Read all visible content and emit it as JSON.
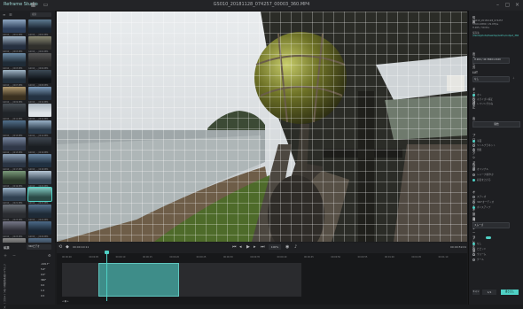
{
  "app": {
    "logo": "Reframe Studio",
    "window_title": "GS010_20181128_074257_00003_360.MP4"
  },
  "left_panel": {
    "search_placeholder": "検索",
    "thumbs": [
      {
        "label": "GS010_..._0001.MP4"
      },
      {
        "label": "GS010_..._0002.MP4"
      },
      {
        "label": "GS010_..._0003.MP4"
      },
      {
        "label": "GS010_..._0004.MP4"
      },
      {
        "label": "GS010_..._0005.MP4"
      },
      {
        "label": "GS010_..._0006.MP4"
      },
      {
        "label": "GS010_..._0007.MP4"
      },
      {
        "label": "GS010_..._0008.MP4"
      },
      {
        "label": "GS010_..._0009.MP4"
      },
      {
        "label": "GS010_..._0010.MP4"
      },
      {
        "label": "GS010_..._0011.MP4"
      },
      {
        "label": "GS010_..._0012.MP4"
      },
      {
        "label": "GS010_..._0013.MP4"
      },
      {
        "label": "GS010_..._0014.MP4"
      },
      {
        "label": "GS010_..._0015.MP4"
      },
      {
        "label": "GS010_..._0016.MP4"
      },
      {
        "label": "GS010_..._0017.MP4"
      },
      {
        "label": "GS010_..._0018.MP4"
      },
      {
        "label": "GS010_..._0019.MP4"
      },
      {
        "label": "GS010_..._0020.MP4"
      },
      {
        "label": "GS010_..._0021.MP4"
      },
      {
        "label": "GS010_..._0022.MP4"
      },
      {
        "label": "GS010_..._0023.MP4"
      },
      {
        "label": "GS010_..._0024.MP4"
      },
      {
        "label": "GS010_..._0025.MP4"
      },
      {
        "label": "GS010_..._0026.MP4"
      },
      {
        "label": "GS010_..._0027.MP4"
      },
      {
        "label": "GS010_..._0028.MP4"
      },
      {
        "label": "GS010_..._0029.MP4"
      },
      {
        "label": "GS010_..._0030.MP4"
      },
      {
        "label": "GS010_..._0031.MP4"
      },
      {
        "label": "GS010_..._0032.MP4"
      }
    ]
  },
  "transport": {
    "timecode_left": "00:00:10:11",
    "zoom": "100%",
    "timecode_right": "00:00:59:01"
  },
  "bottom_left": {
    "section": "編集",
    "dropdown": "360ビデオ",
    "properties": [
      {
        "label": "ヘディング",
        "value": "-109.7°"
      },
      {
        "label": "ピッチ",
        "value": "5.6°"
      },
      {
        "label": "ロール",
        "value": "0.0°"
      },
      {
        "label": "視野",
        "value": "360°"
      },
      {
        "label": "歪み",
        "value": "0.0"
      },
      {
        "label": "ズーム",
        "value": "1.0"
      },
      {
        "label": "スムーズ",
        "value": "0.5"
      }
    ]
  },
  "timeline": {
    "ruler": [
      "00:00:00",
      "00:00:05",
      "00:00:10",
      "00:00:15",
      "00:00:20",
      "00:00:25",
      "00:00:30",
      "00:00:35",
      "00:00:40",
      "00:00:45",
      "00:00:50",
      "00:00:55",
      "00:01:00",
      "00:01:05",
      "00:01:10"
    ],
    "playhead_fraction": 0.11,
    "clip_start_fraction": 0.09,
    "clip_end_fraction": 0.29
  },
  "right_panel": {
    "info_title": "情報",
    "info_lines": [
      "GS010_20181128_074257",
      "5760×2880 / 29.97fps",
      "H.265 / 59.01s"
    ],
    "path_label": "保存先",
    "path_value": "/Users/photo/Desktop/GoPro/output_360...",
    "format_title": "出力形式",
    "format_value": "H.264 / 4K 3840×2160",
    "lut_title": "LUT",
    "lut_value": "なし",
    "stabilize_title": "手ぶれ補正",
    "stabilize_items": [
      "オン",
      "ホライズン補正",
      "レベリングのみ"
    ],
    "output_title": "出力",
    "output_button": "開始",
    "projection_title": "プロジェクション",
    "projection_items": [
      "平面",
      "リトルプラネット",
      "魚眼"
    ],
    "color_title": "色調",
    "color_items": [
      "オリジナル",
      "シャープ/鮮やか",
      "彩度を上げる"
    ],
    "audio_title": "オーディオ設定",
    "audio_items": [
      "ステレオ",
      "360°オーディオ",
      "ボイスアンプ"
    ],
    "keyframe_title": "補間キーフレーム",
    "keyframe_value": "スムーズ",
    "filter_title": "フィルター",
    "filter_items": [
      "なし",
      "ビビッド",
      "ウォーム",
      "クール"
    ],
    "bottom_buttons": {
      "left": "キャンセル",
      "count": "1/1",
      "right": "書き出し"
    },
    "accent": "#4fd1c5"
  }
}
